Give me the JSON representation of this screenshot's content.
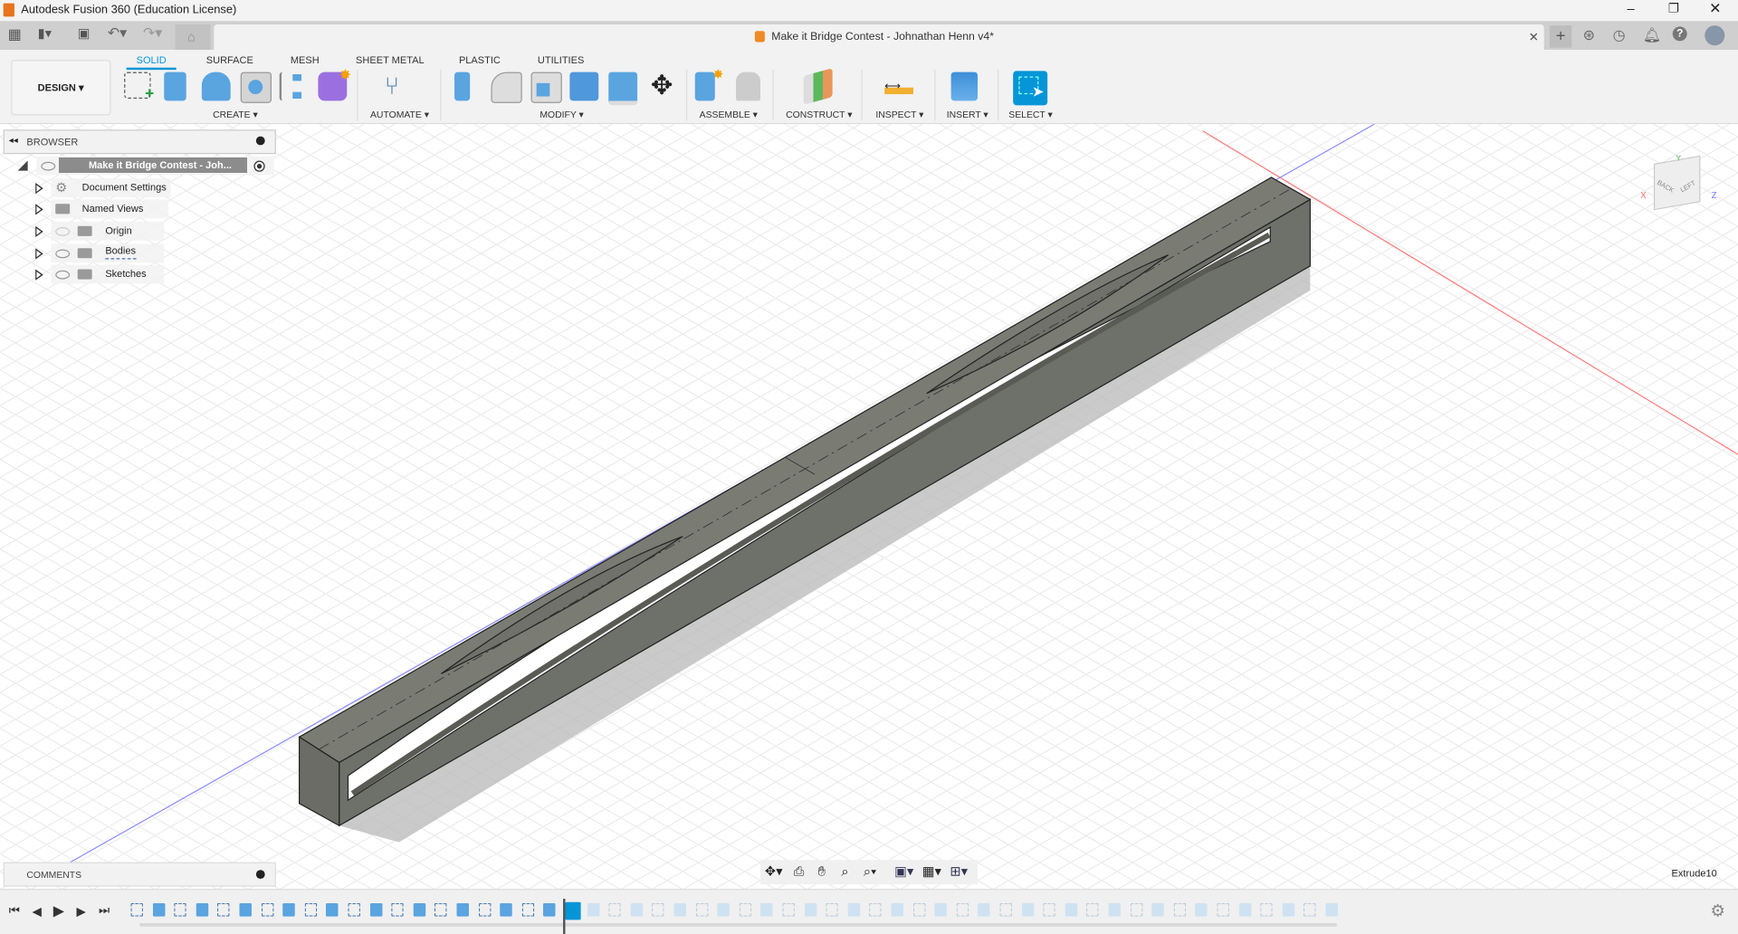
{
  "app": {
    "title": "Autodesk Fusion 360 (Education License)",
    "doc_title": "Make it Bridge Contest - Johnathan Henn v4*"
  },
  "workspace": {
    "label": "DESIGN ▾"
  },
  "ribbon": {
    "tabs": [
      "SOLID",
      "SURFACE",
      "MESH",
      "SHEET METAL",
      "PLASTIC",
      "UTILITIES"
    ],
    "active_tab": "SOLID",
    "groups": [
      "CREATE ▾",
      "AUTOMATE ▾",
      "MODIFY ▾",
      "ASSEMBLE ▾",
      "CONSTRUCT ▾",
      "INSPECT ▾",
      "INSERT ▾",
      "SELECT ▾"
    ]
  },
  "browser": {
    "title": "BROWSER",
    "root": "Make it Bridge Contest - Joh...",
    "items": [
      "Document Settings",
      "Named Views",
      "Origin",
      "Bodies",
      "Sketches"
    ]
  },
  "comments": {
    "title": "COMMENTS"
  },
  "status": {
    "current_feature": "Extrude10"
  },
  "viewcube": {
    "faces": [
      "BACK",
      "LEFT"
    ],
    "axes": [
      "X",
      "Y",
      "Z"
    ]
  },
  "colors": {
    "accent": "#0696d7",
    "body": "#7a7c74",
    "x_axis": "#ff6b6b",
    "z_axis": "#7a7aff"
  },
  "timeline": {
    "active_count": 20,
    "total_count": 56
  }
}
